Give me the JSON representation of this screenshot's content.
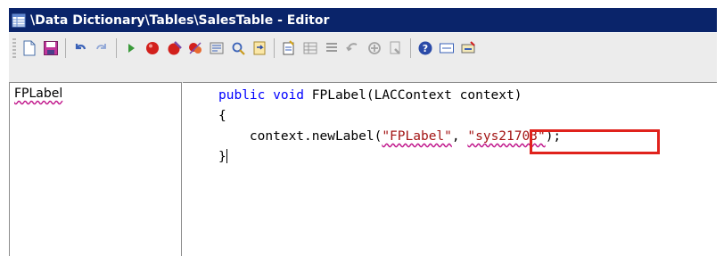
{
  "window": {
    "title": "\\Data Dictionary\\Tables\\SalesTable - Editor",
    "title_icon": "table-editor-icon"
  },
  "toolbar": {
    "groups": [
      [
        "new-icon",
        "save-icon"
      ],
      [
        "undo-icon",
        "redo-icon"
      ],
      [
        "run-icon",
        "breakpoint-icon",
        "remove-breakpoint-icon",
        "clear-breakpoints-icon",
        "compile-icon",
        "lookup-icon",
        "go-to-icon"
      ],
      [
        "new-label-icon",
        "list-tables-icon",
        "list-members-icon",
        "back-icon",
        "forward-icon",
        "scripts-icon"
      ],
      [
        "help-icon",
        "label-file-icon",
        "code-profiler-icon"
      ]
    ]
  },
  "method_list": {
    "items": [
      "FPLabel"
    ]
  },
  "code": {
    "line1_kw": "public void",
    "line1_rest": " FPLabel(LACContext context)",
    "line2": "{",
    "line3_indent": "    context.newLabel(",
    "line3_str1": "\"FPLabel\"",
    "line3_sep": ", ",
    "line3_str2": "\"sys21703\"",
    "line3_end": ");",
    "line4": "}"
  },
  "colors": {
    "title_bar": "#0a246a",
    "keyword": "#0000ff",
    "string": "#a31515",
    "highlight_box": "#e0221c",
    "squiggle": "#c0148a"
  }
}
